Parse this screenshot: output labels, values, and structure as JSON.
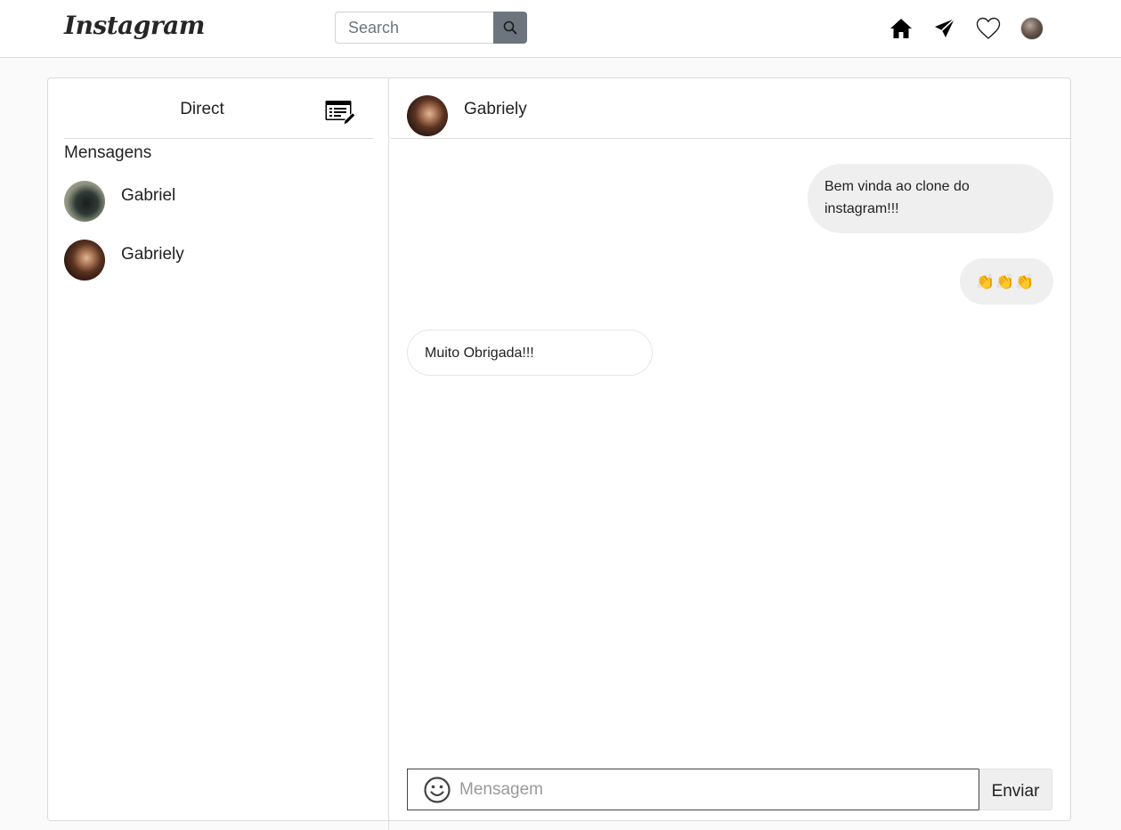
{
  "navbar": {
    "logo_text": "Instagram",
    "search_placeholder": "Search",
    "icons": [
      "home-icon",
      "paper-plane-icon",
      "heart-icon",
      "profile-avatar"
    ]
  },
  "sidebar": {
    "title": "Direct",
    "compose_icon": "compose-message-icon",
    "section_title": "Mensagens",
    "conversations": [
      {
        "name": "Gabriel"
      },
      {
        "name": "Gabriely"
      }
    ]
  },
  "chat": {
    "contact_name": "Gabriely",
    "messages": [
      {
        "direction": "outgoing",
        "text": "Bem vinda ao clone do instagram!!!"
      },
      {
        "direction": "outgoing",
        "text": "👏👏👏"
      },
      {
        "direction": "incoming",
        "text": "Muito Obrigada!!!"
      }
    ],
    "composer": {
      "placeholder": "Mensagem",
      "send_label": "Enviar",
      "emoji_icon": "smiley-icon"
    }
  },
  "colors": {
    "background": "#fafafa",
    "border": "#dbdbdb",
    "outgoing_bubble": "#efefef",
    "search_button": "#6c757d"
  }
}
